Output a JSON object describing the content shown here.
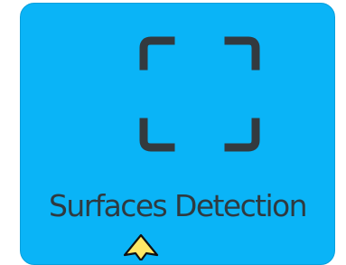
{
  "tile": {
    "label": "Surfaces Detection",
    "icon": "scan-frame-icon",
    "background_color": "#0ab4f7",
    "icon_color": "#333a3f",
    "text_color": "#2f3a40"
  },
  "cursor": {
    "icon": "pointer-cursor-icon",
    "fill_color": "#ffe866"
  }
}
